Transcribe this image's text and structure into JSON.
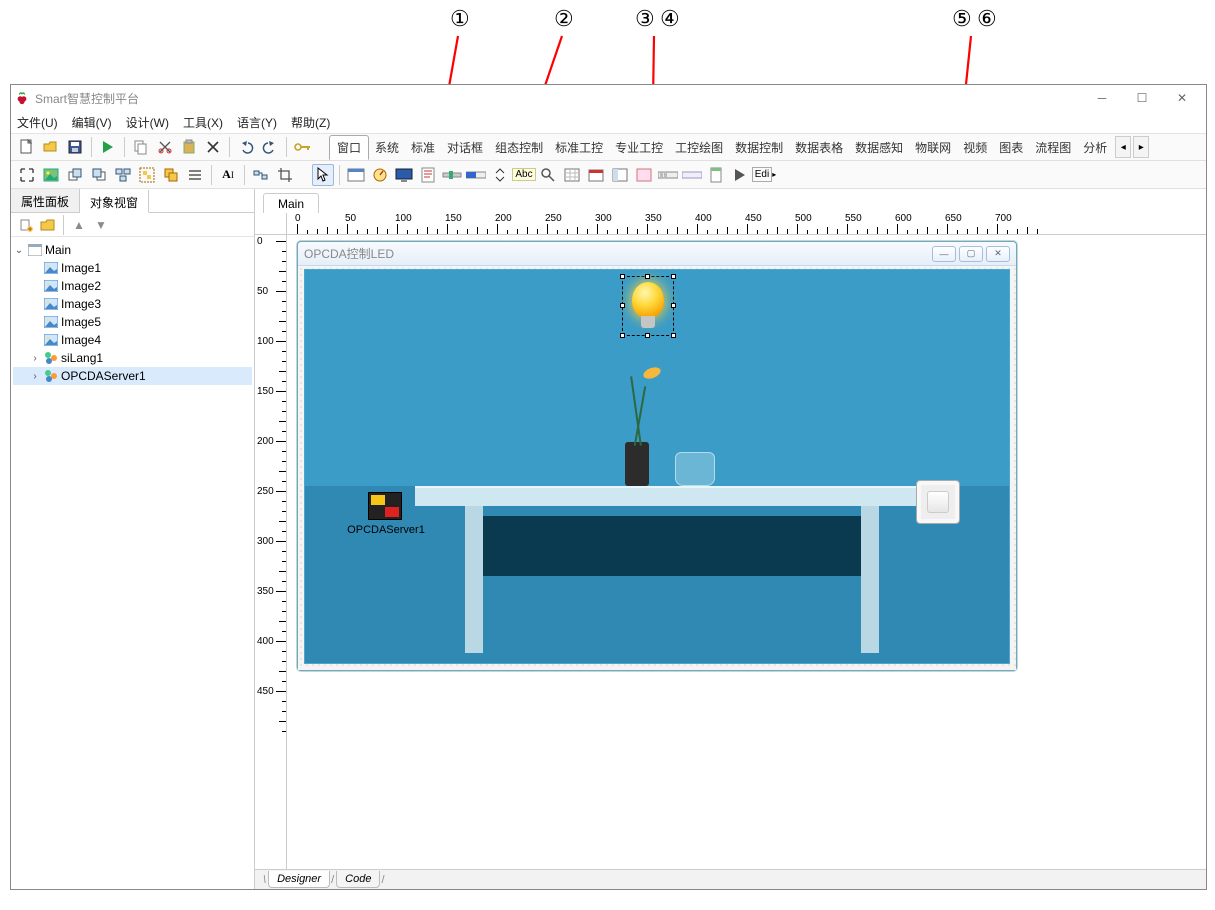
{
  "callouts": [
    "①",
    "②",
    "③",
    "④",
    "⑤",
    "⑥"
  ],
  "app": {
    "title": "Smart智慧控制平台"
  },
  "menubar": [
    "文件(U)",
    "编辑(V)",
    "设计(W)",
    "工具(X)",
    "语言(Y)",
    "帮助(Z)"
  ],
  "cat_tabs": [
    "窗口",
    "系统",
    "标准",
    "对话框",
    "组态控制",
    "标准工控",
    "专业工控",
    "工控绘图",
    "数据控制",
    "数据表格",
    "数据感知",
    "物联网",
    "视频",
    "图表",
    "流程图",
    "分析"
  ],
  "left_tabs": {
    "prop": "属性面板",
    "obj": "对象视窗"
  },
  "tree": {
    "root": "Main",
    "children": [
      "Image1",
      "Image2",
      "Image3",
      "Image5",
      "Image4",
      "siLang1",
      "OPCDAServer1"
    ]
  },
  "doc_tab": "Main",
  "design_window_title": "OPCDA控制LED",
  "opc_label": "OPCDAServer1",
  "bottom_tabs": {
    "designer": "Designer",
    "code": "Code"
  },
  "hruler_ticks": [
    0,
    50,
    100,
    150,
    200,
    250,
    300,
    350,
    400,
    450,
    500,
    550,
    600,
    650,
    700
  ],
  "vruler_ticks": [
    0,
    50,
    100,
    150,
    200,
    250,
    300,
    350,
    400,
    450
  ],
  "toolbar2_edit_label": "Edi"
}
